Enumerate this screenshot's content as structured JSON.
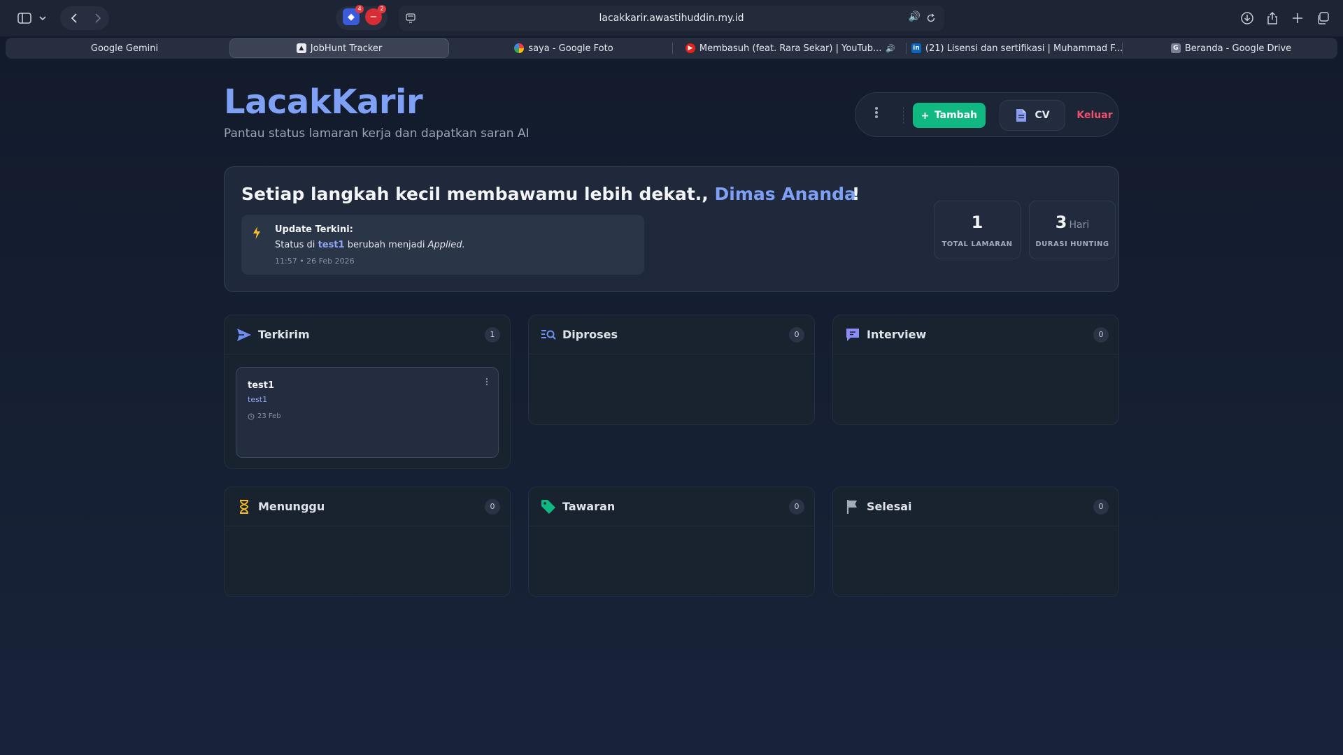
{
  "browser": {
    "url": "lacakkarir.awastihuddin.my.id",
    "extensions": [
      {
        "name": "extension-1",
        "badge": "4"
      },
      {
        "name": "extension-2",
        "badge": "2"
      }
    ],
    "tabs": [
      {
        "label": "Google Gemini",
        "icon": "none"
      },
      {
        "label": "JobHunt Tracker",
        "icon": "jobhunt-icon",
        "active": true
      },
      {
        "label": "saya - Google Foto",
        "icon": "google-photos-icon"
      },
      {
        "label": "Membasuh (feat. Rara Sekar) | YouTub...",
        "icon": "youtube-icon"
      },
      {
        "label": "(21) Lisensi dan sertifikasi | Muhammad F...",
        "icon": "linkedin-icon"
      },
      {
        "label": "Beranda - Google Drive",
        "icon": "google-drive-icon"
      }
    ]
  },
  "header": {
    "logo": "LacakKarir",
    "subtitle": "Pantau status lamaran kerja dan dapatkan saran AI",
    "add_label": "Tambah",
    "cv_label": "CV",
    "logout_label": "Keluar"
  },
  "hero": {
    "greeting_prefix": "Setiap langkah kecil membawamu lebih dekat.,",
    "user_name": "Dimas Ananda",
    "greeting_suffix": "!",
    "update_title": "Update Terkini:",
    "update_text_prefix": "Status di",
    "update_project": "test1",
    "update_text_middle": "berubah menjadi",
    "update_status": "Applied.",
    "update_time": "11:57 • 26 Feb 2026",
    "stats": {
      "total_value": "1",
      "total_label": "TOTAL LAMARAN",
      "duration_value": "3",
      "duration_unit": "Hari",
      "duration_label": "DURASI HUNTING"
    }
  },
  "colors": {
    "accent": "#7ea0f5",
    "add_button": "#10b981",
    "logout": "#f0506e",
    "menunggu_icon": "#fbbf24",
    "tawaran_icon": "#10b981"
  },
  "columns": {
    "terkirim": {
      "title": "Terkirim",
      "count": "1",
      "icon": "send-icon",
      "cards": [
        {
          "title": "test1",
          "company": "test1",
          "date": "23 Feb"
        }
      ]
    },
    "diproses": {
      "title": "Diproses",
      "count": "0",
      "icon": "search-list-icon"
    },
    "interview": {
      "title": "Interview",
      "count": "0",
      "icon": "chat-icon"
    },
    "menunggu": {
      "title": "Menunggu",
      "count": "0",
      "icon": "hourglass-icon"
    },
    "tawaran": {
      "title": "Tawaran",
      "count": "0",
      "icon": "tag-icon"
    },
    "selesai": {
      "title": "Selesai",
      "count": "0",
      "icon": "flag-icon"
    }
  }
}
